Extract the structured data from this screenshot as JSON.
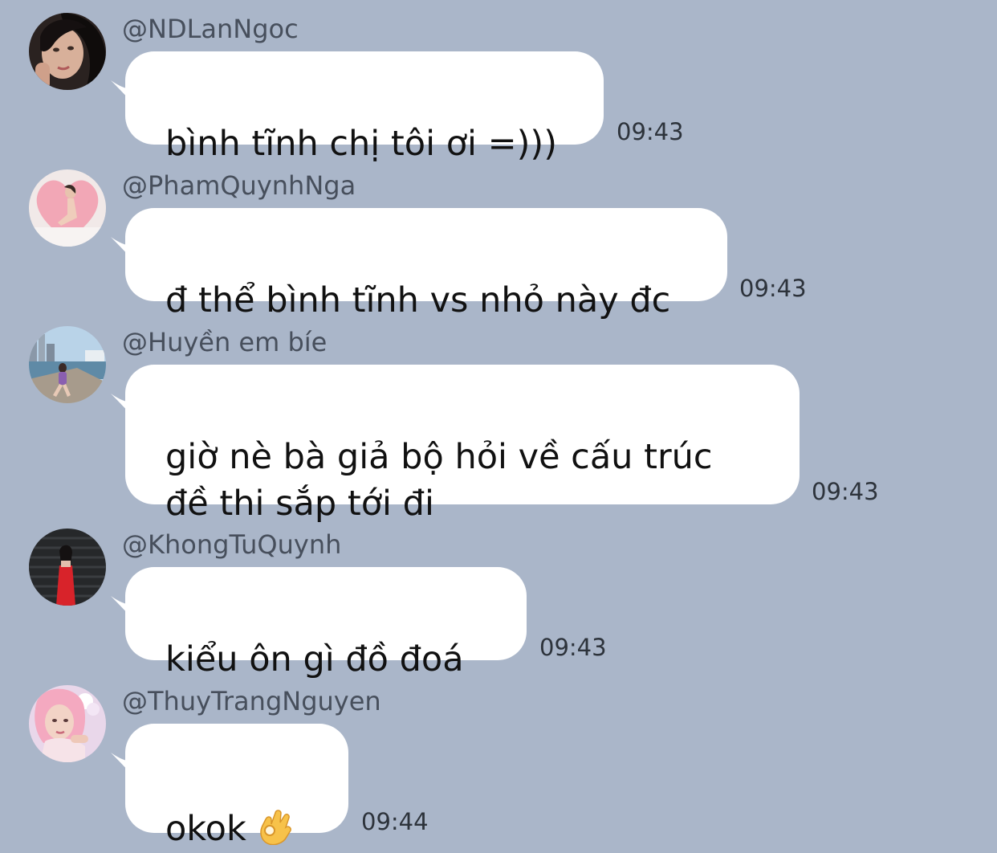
{
  "colors": {
    "background": "#aab6c9",
    "bubble": "#ffffff",
    "sender_text": "#474f5c",
    "time_text": "#2d333b"
  },
  "messages": [
    {
      "sender": "@NDLanNgoc",
      "text": "bình tĩnh chị tôi ơi =)))",
      "time": "09:43",
      "avatar_icon": "avatar-woman-dark-hair"
    },
    {
      "sender": "@PhamQuynhNga",
      "text": "đ thể bình tĩnh vs nhỏ này đc",
      "time": "09:43",
      "avatar_icon": "avatar-woman-pink-heart"
    },
    {
      "sender": "@Huyền em bíe",
      "text": "giờ nè bà giả bộ hỏi về cấu trúc\nđề thi sắp tới đi",
      "time": "09:43",
      "avatar_icon": "avatar-woman-harbor"
    },
    {
      "sender": "@KhongTuQuynh",
      "text": "kiểu ôn gì đồ đoá",
      "time": "09:43",
      "avatar_icon": "avatar-woman-red-dress"
    },
    {
      "sender": "@ThuyTrangNguyen",
      "text": "okok",
      "emoji": "ok-hand-emoji-icon",
      "time": "09:44",
      "avatar_icon": "avatar-woman-pink-hair"
    }
  ]
}
